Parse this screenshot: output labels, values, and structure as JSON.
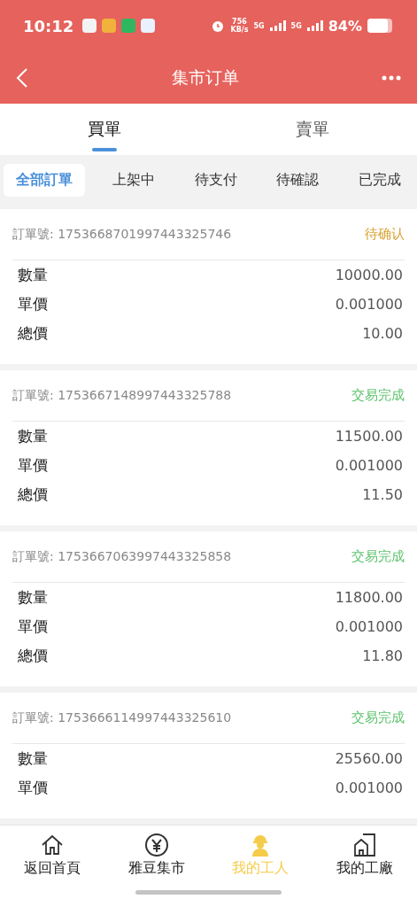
{
  "status_bar": {
    "time": "10:12",
    "net_speed": "756",
    "net_unit": "KB/s",
    "signal_1": "5G",
    "signal_2": "5G",
    "battery": "84%"
  },
  "nav": {
    "title": "集市订单"
  },
  "tabs": [
    {
      "label": "買單",
      "selected": true
    },
    {
      "label": "賣單",
      "selected": false
    }
  ],
  "filters": [
    {
      "label": "全部訂單",
      "selected": true
    },
    {
      "label": "上架中",
      "selected": false
    },
    {
      "label": "待支付",
      "selected": false
    },
    {
      "label": "待確認",
      "selected": false
    },
    {
      "label": "已完成",
      "selected": false
    }
  ],
  "orders": [
    {
      "number": "訂單號: 1753668701997443325746",
      "status": "待确认",
      "color": "#d9a233",
      "rows": [
        {
          "label": "數量",
          "value": "10000.00"
        },
        {
          "label": "單價",
          "value": "0.001000"
        },
        {
          "label": "總價",
          "value": "10.00"
        }
      ]
    },
    {
      "number": "訂單號: 1753667148997443325788",
      "status": "交易完成",
      "color": "#5cc26b",
      "rows": [
        {
          "label": "數量",
          "value": "11500.00"
        },
        {
          "label": "單價",
          "value": "0.001000"
        },
        {
          "label": "總價",
          "value": "11.50"
        }
      ]
    },
    {
      "number": "訂單號: 1753667063997443325858",
      "status": "交易完成",
      "color": "#5cc26b",
      "rows": [
        {
          "label": "數量",
          "value": "11800.00"
        },
        {
          "label": "單價",
          "value": "0.001000"
        },
        {
          "label": "總價",
          "value": "11.80"
        }
      ]
    },
    {
      "number": "訂單號: 1753666114997443325610",
      "status": "交易完成",
      "color": "#5cc26b",
      "rows": [
        {
          "label": "數量",
          "value": "25560.00"
        },
        {
          "label": "單價",
          "value": "0.001000"
        }
      ]
    }
  ],
  "bottom_nav": [
    {
      "label": "返回首頁",
      "selected": false
    },
    {
      "label": "雅豆集市",
      "selected": false
    },
    {
      "label": "我的工人",
      "selected": true
    },
    {
      "label": "我的工廠",
      "selected": false
    }
  ]
}
